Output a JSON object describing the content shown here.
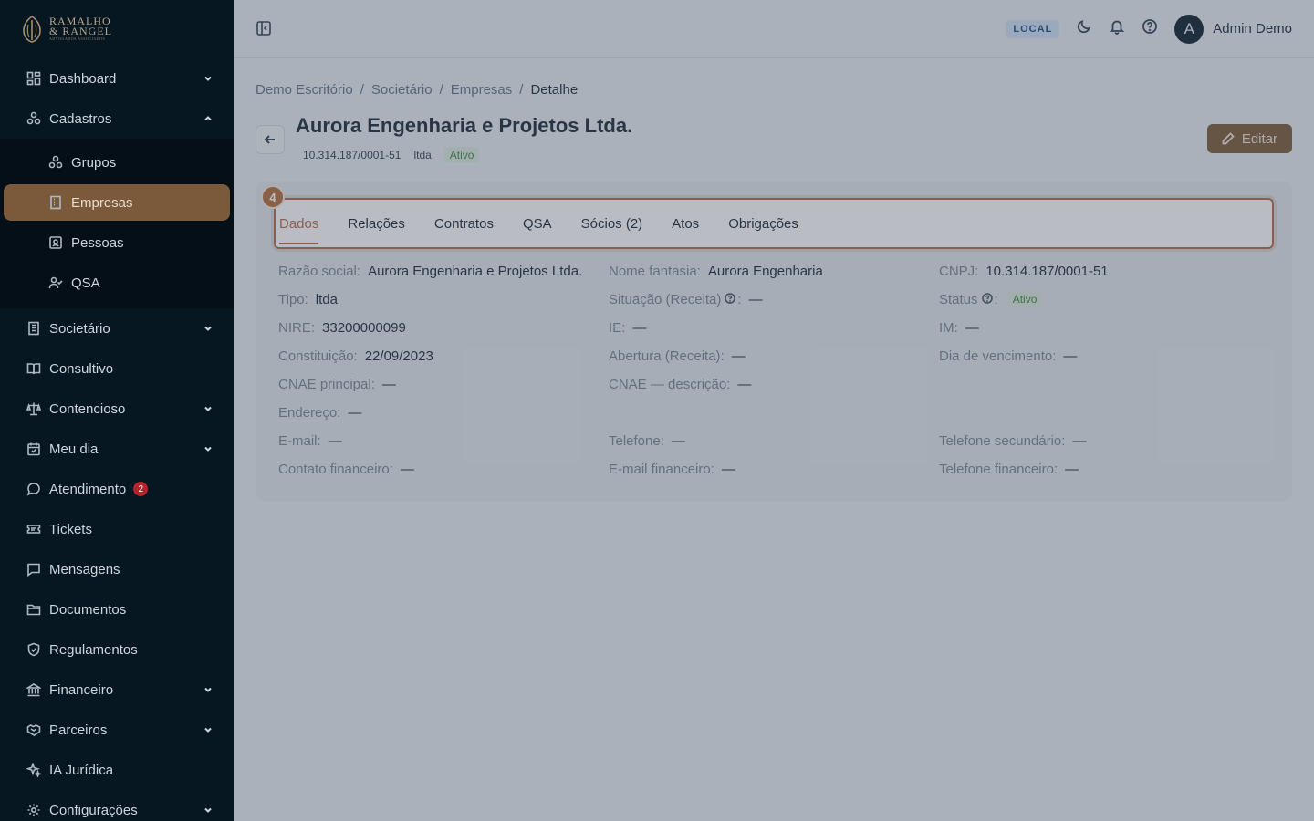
{
  "brand": {
    "line1": "RAMALHO",
    "line2": "& RANGEL",
    "line3": "ADVOGADOS ASSOCIADOS"
  },
  "sidebar": {
    "items": [
      {
        "label": "Dashboard",
        "icon": "dashboard-icon",
        "chevron": "down"
      },
      {
        "label": "Cadastros",
        "icon": "cadastros-icon",
        "chevron": "up"
      },
      {
        "label": "Societário",
        "icon": "building-icon",
        "chevron": "down"
      },
      {
        "label": "Consultivo",
        "icon": "book-icon"
      },
      {
        "label": "Contencioso",
        "icon": "scale-icon",
        "chevron": "down"
      },
      {
        "label": "Meu dia",
        "icon": "calendar-icon",
        "chevron": "down"
      },
      {
        "label": "Atendimento",
        "icon": "chat-icon",
        "badge": "2"
      },
      {
        "label": "Tickets",
        "icon": "ticket-icon"
      },
      {
        "label": "Mensagens",
        "icon": "message-icon"
      },
      {
        "label": "Documentos",
        "icon": "folder-icon"
      },
      {
        "label": "Regulamentos",
        "icon": "shield-icon"
      },
      {
        "label": "Financeiro",
        "icon": "bank-icon",
        "chevron": "down"
      },
      {
        "label": "Parceiros",
        "icon": "handshake-icon",
        "chevron": "down"
      },
      {
        "label": "IA Jurídica",
        "icon": "sparkles-icon"
      },
      {
        "label": "Configurações",
        "icon": "gear-icon",
        "chevron": "down"
      }
    ],
    "sub_items": [
      {
        "label": "Grupos",
        "icon": "group-icon"
      },
      {
        "label": "Empresas",
        "icon": "company-icon",
        "active": true
      },
      {
        "label": "Pessoas",
        "icon": "person-card-icon"
      },
      {
        "label": "QSA",
        "icon": "user-check-icon"
      }
    ]
  },
  "topbar": {
    "env": "LOCAL",
    "user_initial": "A",
    "user_name": "Admin Demo"
  },
  "breadcrumb": [
    "Demo Escritório",
    "Societário",
    "Empresas",
    "Detalhe"
  ],
  "company": {
    "name": "Aurora Engenharia e Projetos Ltda.",
    "cnpj": "10.314.187/0001-51",
    "type": "ltda",
    "status": "Ativo"
  },
  "actions": {
    "edit": "Editar"
  },
  "tour_step": "4",
  "tabs": [
    "Dados",
    "Relações",
    "Contratos",
    "QSA",
    "Sócios (2)",
    "Atos",
    "Obrigações"
  ],
  "fields": [
    {
      "label": "Razão social",
      "value": "Aurora Engenharia e Projetos Ltda."
    },
    {
      "label": "Nome fantasia",
      "value": "Aurora Engenharia"
    },
    {
      "label": "CNPJ",
      "value": "10.314.187/0001-51"
    },
    {
      "label": "Tipo",
      "value": "ltda"
    },
    {
      "label": "Situação (Receita)",
      "value": "—",
      "help": true
    },
    {
      "label": "Status",
      "value": "Ativo",
      "help": true,
      "pill": true
    },
    {
      "label": "NIRE",
      "value": "33200000099"
    },
    {
      "label": "IE",
      "value": "—"
    },
    {
      "label": "IM",
      "value": "—"
    },
    {
      "label": "Constituição",
      "value": "22/09/2023"
    },
    {
      "label": "Abertura (Receita)",
      "value": "—"
    },
    {
      "label": "Dia de vencimento",
      "value": "—"
    },
    {
      "label": "CNAE principal",
      "value": "—"
    },
    {
      "label": "CNAE — descrição",
      "value": "—"
    },
    {
      "label": "",
      "value": ""
    },
    {
      "label": "Endereço",
      "value": "—"
    },
    {
      "label": "",
      "value": ""
    },
    {
      "label": "",
      "value": ""
    },
    {
      "label": "E-mail",
      "value": "—"
    },
    {
      "label": "Telefone",
      "value": "—"
    },
    {
      "label": "Telefone secundário",
      "value": "—"
    },
    {
      "label": "Contato financeiro",
      "value": "—"
    },
    {
      "label": "E-mail financeiro",
      "value": "—"
    },
    {
      "label": "Telefone financeiro",
      "value": "—"
    }
  ],
  "colors": {
    "sidebar_bg": "#061722",
    "accent": "#7d5b3b",
    "tab_accent": "#b86b4a",
    "success": "#3c8a3c"
  }
}
